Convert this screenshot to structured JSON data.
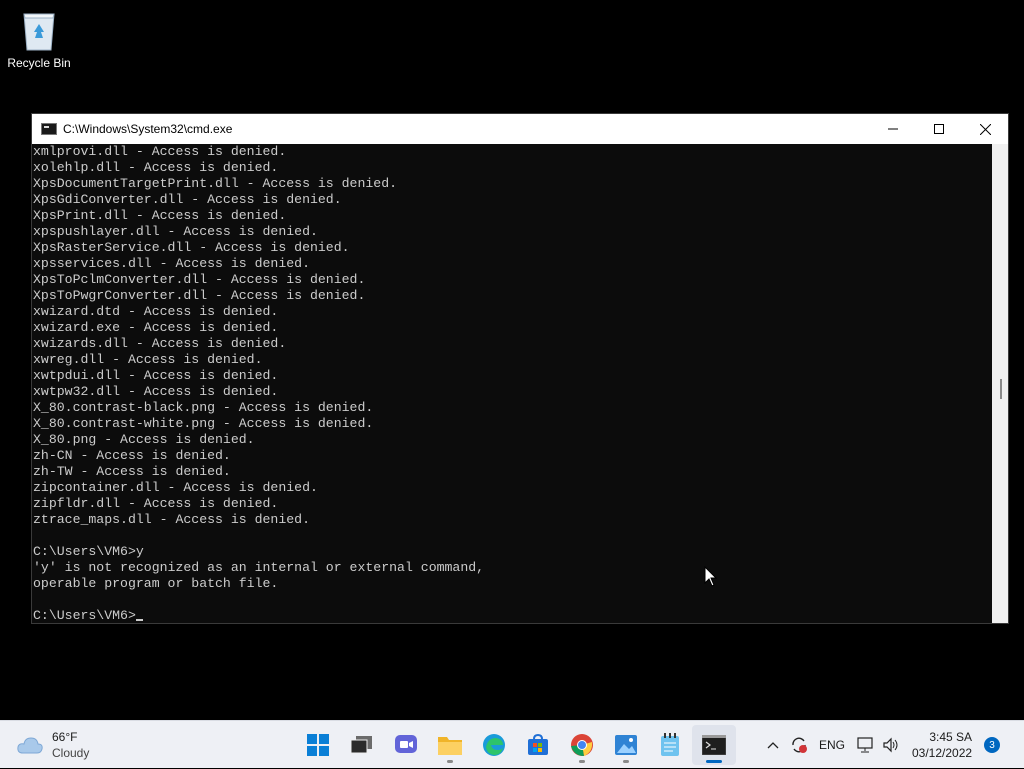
{
  "desktop": {
    "recycle_bin_label": "Recycle Bin"
  },
  "window": {
    "title": "C:\\Windows\\System32\\cmd.exe"
  },
  "console": {
    "lines": [
      "xmlprovi.dll - Access is denied.",
      "xolehlp.dll - Access is denied.",
      "XpsDocumentTargetPrint.dll - Access is denied.",
      "XpsGdiConverter.dll - Access is denied.",
      "XpsPrint.dll - Access is denied.",
      "xpspushlayer.dll - Access is denied.",
      "XpsRasterService.dll - Access is denied.",
      "xpsservices.dll - Access is denied.",
      "XpsToPclmConverter.dll - Access is denied.",
      "XpsToPwgrConverter.dll - Access is denied.",
      "xwizard.dtd - Access is denied.",
      "xwizard.exe - Access is denied.",
      "xwizards.dll - Access is denied.",
      "xwreg.dll - Access is denied.",
      "xwtpdui.dll - Access is denied.",
      "xwtpw32.dll - Access is denied.",
      "X_80.contrast-black.png - Access is denied.",
      "X_80.contrast-white.png - Access is denied.",
      "X_80.png - Access is denied.",
      "zh-CN - Access is denied.",
      "zh-TW - Access is denied.",
      "zipcontainer.dll - Access is denied.",
      "zipfldr.dll - Access is denied.",
      "ztrace_maps.dll - Access is denied.",
      "",
      "C:\\Users\\VM6>y",
      "'y' is not recognized as an internal or external command,",
      "operable program or batch file.",
      ""
    ],
    "prompt": "C:\\Users\\VM6>"
  },
  "taskbar": {
    "weather_temp": "66°F",
    "weather_cond": "Cloudy",
    "apps": [
      {
        "name": "start-icon"
      },
      {
        "name": "task-view-icon"
      },
      {
        "name": "chat-icon"
      },
      {
        "name": "file-explorer-icon"
      },
      {
        "name": "edge-icon"
      },
      {
        "name": "store-icon"
      },
      {
        "name": "chrome-icon"
      },
      {
        "name": "photos-icon"
      },
      {
        "name": "notepad-icon"
      },
      {
        "name": "terminal-icon"
      }
    ],
    "language": "ENG",
    "time": "3:45 SA",
    "date": "03/12/2022",
    "notification_count": "3"
  },
  "colors": {
    "console_bg": "#0c0c0c",
    "console_text": "#cccccc",
    "accent": "#0067c0"
  }
}
